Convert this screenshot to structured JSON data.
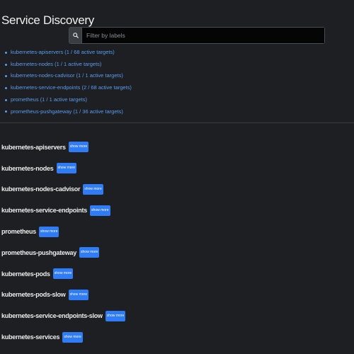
{
  "page": {
    "title": "Service Discovery"
  },
  "search": {
    "placeholder": "Filter by labels",
    "icon": "search-icon"
  },
  "jobs": [
    "kubernetes-apiservers (1 / 68 active targets)",
    "kubernetes-nodes (1 / 1 active targets)",
    "kubernetes-nodes-cadvisor (1 / 1 active targets)",
    "kubernetes-service-endpoints (2 / 68 active targets)",
    "prometheus (1 / 1 active targets)",
    "prometheus-pushgateway (1 / 36 active targets)"
  ],
  "show_more_label": "show more",
  "sections": [
    "kubernetes-apiservers",
    "kubernetes-nodes",
    "kubernetes-nodes-cadvisor",
    "kubernetes-service-endpoints",
    "prometheus",
    "prometheus-pushgateway",
    "kubernetes-pods",
    "kubernetes-pods-slow",
    "kubernetes-service-endpoints-slow",
    "kubernetes-services"
  ],
  "colors": {
    "background": "#1d1f22",
    "link": "#5b9cf0",
    "button": "#2f7cf6"
  }
}
